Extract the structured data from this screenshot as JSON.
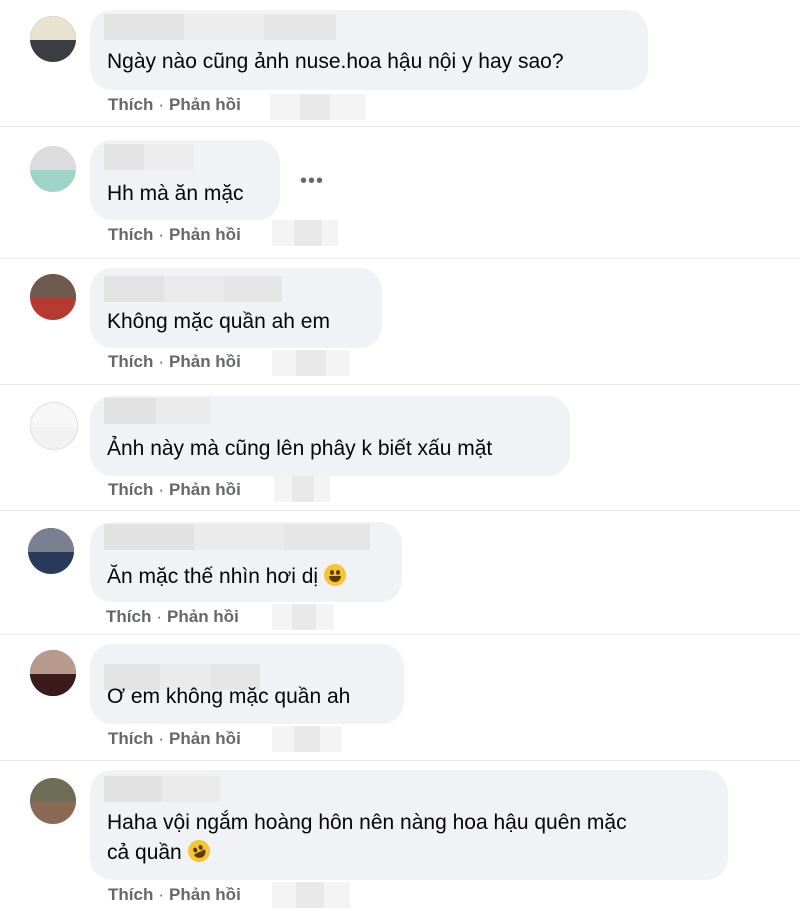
{
  "comments": [
    {
      "text": "Ngày nào cũng ảnh nuse.hoa hậu nội y hay sao?",
      "like": "Thích",
      "reply": "Phản hồi"
    },
    {
      "text": "Hh mà ăn mặc",
      "like": "Thích",
      "reply": "Phản hồi"
    },
    {
      "text": "Không mặc quần ah em",
      "like": "Thích",
      "reply": "Phản hồi"
    },
    {
      "text": "Ảnh này mà cũng lên phây k biết xấu mặt",
      "like": "Thích",
      "reply": "Phản hồi"
    },
    {
      "text": "Ăn mặc thế nhìn hơi dị",
      "like": "Thích",
      "reply": "Phản hồi"
    },
    {
      "text": "Ơ em không mặc quần ah",
      "like": "Thích",
      "reply": "Phản hồi"
    },
    {
      "text_line1": "Haha vội ngắm hoàng hôn nên nàng hoa hậu quên mặc",
      "text_line2": "cả quần",
      "like": "Thích",
      "reply": "Phản hồi"
    }
  ],
  "separator": "·",
  "more_options": "•••",
  "icons": {
    "grinning": "grinning-emoji-icon",
    "laughing": "rofl-emoji-icon"
  }
}
